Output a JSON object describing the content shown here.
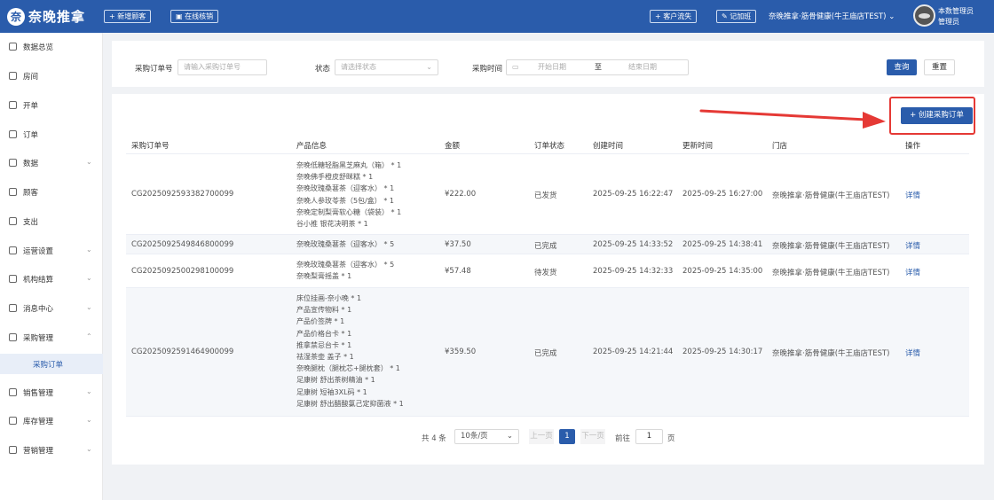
{
  "header": {
    "logo_mark": "奈",
    "logo_text": "奈晚推拿",
    "new_guest": "+ 新增顾客",
    "online_writeoff": "在线核销",
    "customer_churn": "+ 客户流失",
    "record_add": "记加班",
    "store": "奈晚推拿·筋骨健康(牛王庙店TEST) ⌄",
    "user_line1": "本数管理员",
    "user_line2": "管理员"
  },
  "sidebar": {
    "items": [
      {
        "label": "数据总览",
        "chevron": ""
      },
      {
        "label": "房间",
        "chevron": ""
      },
      {
        "label": "开单",
        "chevron": ""
      },
      {
        "label": "订单",
        "chevron": ""
      },
      {
        "label": "数据",
        "chevron": "⌄"
      },
      {
        "label": "顾客",
        "chevron": ""
      },
      {
        "label": "支出",
        "chevron": ""
      },
      {
        "label": "运营设置",
        "chevron": "⌄"
      },
      {
        "label": "机构结算",
        "chevron": "⌄"
      },
      {
        "label": "消息中心",
        "chevron": "⌄"
      },
      {
        "label": "采购管理",
        "chevron": "⌃"
      },
      {
        "label": "销售管理",
        "chevron": "⌄"
      },
      {
        "label": "库存管理",
        "chevron": "⌄"
      },
      {
        "label": "营销管理",
        "chevron": "⌄"
      }
    ],
    "sub_active": "采购订单"
  },
  "filters": {
    "order_no_label": "采购订单号",
    "order_no_placeholder": "请输入采购订单号",
    "status_label": "状态",
    "status_placeholder": "请选择状态",
    "time_label": "采购时间",
    "start_placeholder": "开始日期",
    "to": "至",
    "end_placeholder": "结束日期",
    "query": "查询",
    "reset": "重置"
  },
  "toolbar": {
    "create": "+ 创建采购订单"
  },
  "table": {
    "headers": [
      "采购订单号",
      "产品信息",
      "金额",
      "订单状态",
      "创建时间",
      "更新时间",
      "门店",
      "操作"
    ],
    "rows": [
      {
        "order_no": "CG2025092593382700099",
        "products": [
          "奈晚低糖轻脂黑芝麻丸（箱） * 1",
          "奈晚佛手橙皮舒眯糕 * 1",
          "奈晚玫瑰桑葚茶（迎客水） * 1",
          "奈晚人参玫苓茶（5包/盒） * 1",
          "奈晚定制梨膏软心糖（袋装） * 1",
          "谷小推 银花决明茶 * 1"
        ],
        "amount": "¥222.00",
        "status": "已发货",
        "created": "2025-09-25 16:22:47",
        "updated": "2025-09-25 16:27:00",
        "store": "奈晚推拿·筋骨健康(牛王庙店TEST)",
        "action": "详情"
      },
      {
        "order_no": "CG2025092549846800099",
        "products": [
          "奈晚玫瑰桑葚茶（迎客水） * 5"
        ],
        "amount": "¥37.50",
        "status": "已完成",
        "created": "2025-09-25 14:33:52",
        "updated": "2025-09-25 14:38:41",
        "store": "奈晚推拿·筋骨健康(牛王庙店TEST)",
        "action": "详情"
      },
      {
        "order_no": "CG2025092500298100099",
        "products": [
          "奈晚玫瑰桑葚茶（迎客水） * 5",
          "奈晚梨膏摇盖 * 1"
        ],
        "amount": "¥57.48",
        "status": "待发货",
        "created": "2025-09-25 14:32:33",
        "updated": "2025-09-25 14:35:00",
        "store": "奈晚推拿·筋骨健康(牛王庙店TEST)",
        "action": "详情"
      },
      {
        "order_no": "CG2025092591464900099",
        "products": [
          "床位挂画-奈小晚 * 1",
          "产品宣传物料 * 1",
          "产品价签牌 * 1",
          "产品价格台卡 * 1",
          "推拿禁忌台卡 * 1",
          "祛湿茶壶 盖子 * 1",
          "奈晚腿枕（腿枕芯+腿枕套） * 1",
          "足康树 舒出茶树精油 * 1",
          "足康树 短袖3XL码 * 1",
          "足康树 舒出醋酸氯己定抑菌液 * 1"
        ],
        "amount": "¥359.50",
        "status": "已完成",
        "created": "2025-09-25 14:21:44",
        "updated": "2025-09-25 14:30:17",
        "store": "奈晚推拿·筋骨健康(牛王庙店TEST)",
        "action": "详情"
      }
    ]
  },
  "pagination": {
    "total": "共 4 条",
    "page_size": "10条/页",
    "prev": "上一页",
    "current": "1",
    "next": "下一页",
    "goto": "前往",
    "goto_value": "1",
    "page_suffix": "页"
  }
}
